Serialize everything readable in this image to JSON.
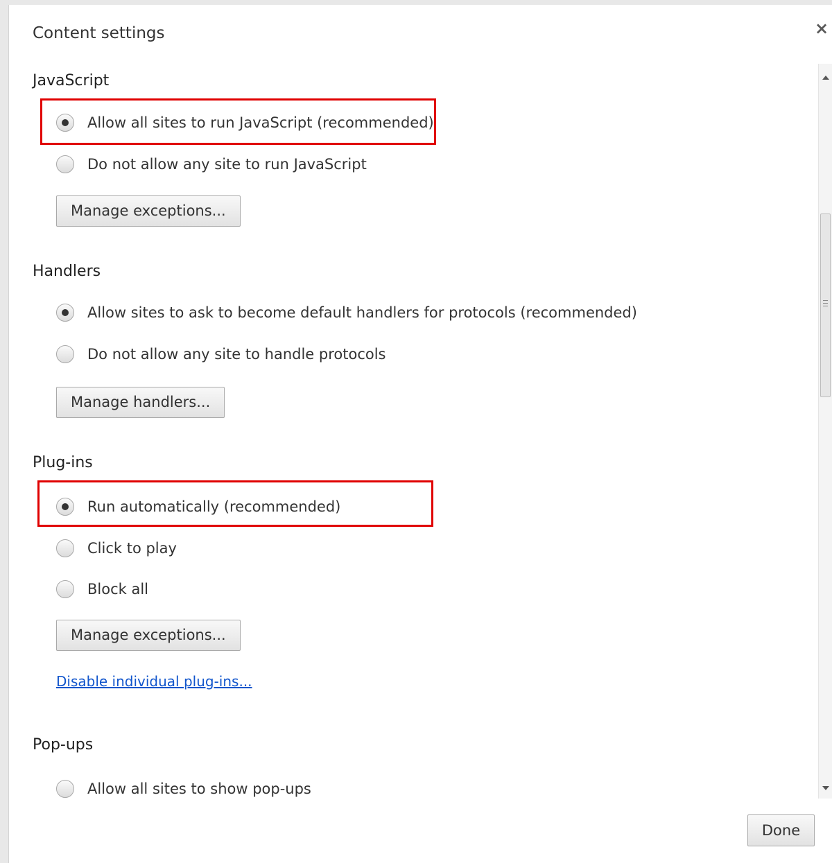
{
  "dialog": {
    "title": "Content settings",
    "close_icon": "close-icon",
    "done_label": "Done"
  },
  "sections": {
    "javascript": {
      "title": "JavaScript",
      "options": [
        {
          "label": "Allow all sites to run JavaScript (recommended)",
          "checked": true
        },
        {
          "label": "Do not allow any site to run JavaScript",
          "checked": false
        }
      ],
      "button_label": "Manage exceptions..."
    },
    "handlers": {
      "title": "Handlers",
      "options": [
        {
          "label": "Allow sites to ask to become default handlers for protocols (recommended)",
          "checked": true
        },
        {
          "label": "Do not allow any site to handle protocols",
          "checked": false
        }
      ],
      "button_label": "Manage handlers..."
    },
    "plugins": {
      "title": "Plug-ins",
      "options": [
        {
          "label": "Run automatically (recommended)",
          "checked": true
        },
        {
          "label": "Click to play",
          "checked": false
        },
        {
          "label": "Block all",
          "checked": false
        }
      ],
      "button_label": "Manage exceptions...",
      "link_label": "Disable individual plug-ins..."
    },
    "popups": {
      "title": "Pop-ups",
      "options": [
        {
          "label": "Allow all sites to show pop-ups",
          "checked": false
        }
      ]
    }
  },
  "colors": {
    "highlight_border": "#e00000",
    "link": "#1155cc"
  }
}
